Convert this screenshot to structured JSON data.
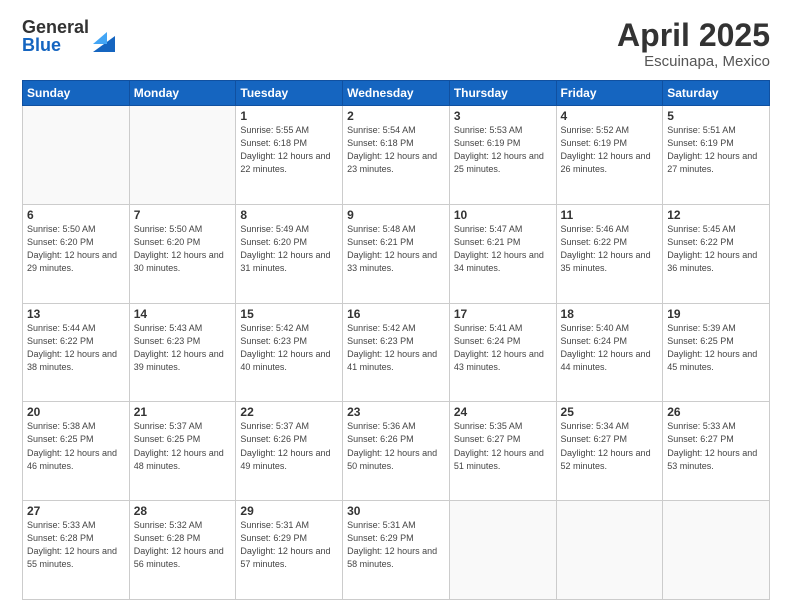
{
  "header": {
    "logo_general": "General",
    "logo_blue": "Blue",
    "title": "April 2025",
    "subtitle": "Escuinapa, Mexico"
  },
  "weekdays": [
    "Sunday",
    "Monday",
    "Tuesday",
    "Wednesday",
    "Thursday",
    "Friday",
    "Saturday"
  ],
  "weeks": [
    [
      {
        "day": "",
        "info": ""
      },
      {
        "day": "",
        "info": ""
      },
      {
        "day": "1",
        "info": "Sunrise: 5:55 AM\nSunset: 6:18 PM\nDaylight: 12 hours and 22 minutes."
      },
      {
        "day": "2",
        "info": "Sunrise: 5:54 AM\nSunset: 6:18 PM\nDaylight: 12 hours and 23 minutes."
      },
      {
        "day": "3",
        "info": "Sunrise: 5:53 AM\nSunset: 6:19 PM\nDaylight: 12 hours and 25 minutes."
      },
      {
        "day": "4",
        "info": "Sunrise: 5:52 AM\nSunset: 6:19 PM\nDaylight: 12 hours and 26 minutes."
      },
      {
        "day": "5",
        "info": "Sunrise: 5:51 AM\nSunset: 6:19 PM\nDaylight: 12 hours and 27 minutes."
      }
    ],
    [
      {
        "day": "6",
        "info": "Sunrise: 5:50 AM\nSunset: 6:20 PM\nDaylight: 12 hours and 29 minutes."
      },
      {
        "day": "7",
        "info": "Sunrise: 5:50 AM\nSunset: 6:20 PM\nDaylight: 12 hours and 30 minutes."
      },
      {
        "day": "8",
        "info": "Sunrise: 5:49 AM\nSunset: 6:20 PM\nDaylight: 12 hours and 31 minutes."
      },
      {
        "day": "9",
        "info": "Sunrise: 5:48 AM\nSunset: 6:21 PM\nDaylight: 12 hours and 33 minutes."
      },
      {
        "day": "10",
        "info": "Sunrise: 5:47 AM\nSunset: 6:21 PM\nDaylight: 12 hours and 34 minutes."
      },
      {
        "day": "11",
        "info": "Sunrise: 5:46 AM\nSunset: 6:22 PM\nDaylight: 12 hours and 35 minutes."
      },
      {
        "day": "12",
        "info": "Sunrise: 5:45 AM\nSunset: 6:22 PM\nDaylight: 12 hours and 36 minutes."
      }
    ],
    [
      {
        "day": "13",
        "info": "Sunrise: 5:44 AM\nSunset: 6:22 PM\nDaylight: 12 hours and 38 minutes."
      },
      {
        "day": "14",
        "info": "Sunrise: 5:43 AM\nSunset: 6:23 PM\nDaylight: 12 hours and 39 minutes."
      },
      {
        "day": "15",
        "info": "Sunrise: 5:42 AM\nSunset: 6:23 PM\nDaylight: 12 hours and 40 minutes."
      },
      {
        "day": "16",
        "info": "Sunrise: 5:42 AM\nSunset: 6:23 PM\nDaylight: 12 hours and 41 minutes."
      },
      {
        "day": "17",
        "info": "Sunrise: 5:41 AM\nSunset: 6:24 PM\nDaylight: 12 hours and 43 minutes."
      },
      {
        "day": "18",
        "info": "Sunrise: 5:40 AM\nSunset: 6:24 PM\nDaylight: 12 hours and 44 minutes."
      },
      {
        "day": "19",
        "info": "Sunrise: 5:39 AM\nSunset: 6:25 PM\nDaylight: 12 hours and 45 minutes."
      }
    ],
    [
      {
        "day": "20",
        "info": "Sunrise: 5:38 AM\nSunset: 6:25 PM\nDaylight: 12 hours and 46 minutes."
      },
      {
        "day": "21",
        "info": "Sunrise: 5:37 AM\nSunset: 6:25 PM\nDaylight: 12 hours and 48 minutes."
      },
      {
        "day": "22",
        "info": "Sunrise: 5:37 AM\nSunset: 6:26 PM\nDaylight: 12 hours and 49 minutes."
      },
      {
        "day": "23",
        "info": "Sunrise: 5:36 AM\nSunset: 6:26 PM\nDaylight: 12 hours and 50 minutes."
      },
      {
        "day": "24",
        "info": "Sunrise: 5:35 AM\nSunset: 6:27 PM\nDaylight: 12 hours and 51 minutes."
      },
      {
        "day": "25",
        "info": "Sunrise: 5:34 AM\nSunset: 6:27 PM\nDaylight: 12 hours and 52 minutes."
      },
      {
        "day": "26",
        "info": "Sunrise: 5:33 AM\nSunset: 6:27 PM\nDaylight: 12 hours and 53 minutes."
      }
    ],
    [
      {
        "day": "27",
        "info": "Sunrise: 5:33 AM\nSunset: 6:28 PM\nDaylight: 12 hours and 55 minutes."
      },
      {
        "day": "28",
        "info": "Sunrise: 5:32 AM\nSunset: 6:28 PM\nDaylight: 12 hours and 56 minutes."
      },
      {
        "day": "29",
        "info": "Sunrise: 5:31 AM\nSunset: 6:29 PM\nDaylight: 12 hours and 57 minutes."
      },
      {
        "day": "30",
        "info": "Sunrise: 5:31 AM\nSunset: 6:29 PM\nDaylight: 12 hours and 58 minutes."
      },
      {
        "day": "",
        "info": ""
      },
      {
        "day": "",
        "info": ""
      },
      {
        "day": "",
        "info": ""
      }
    ]
  ]
}
